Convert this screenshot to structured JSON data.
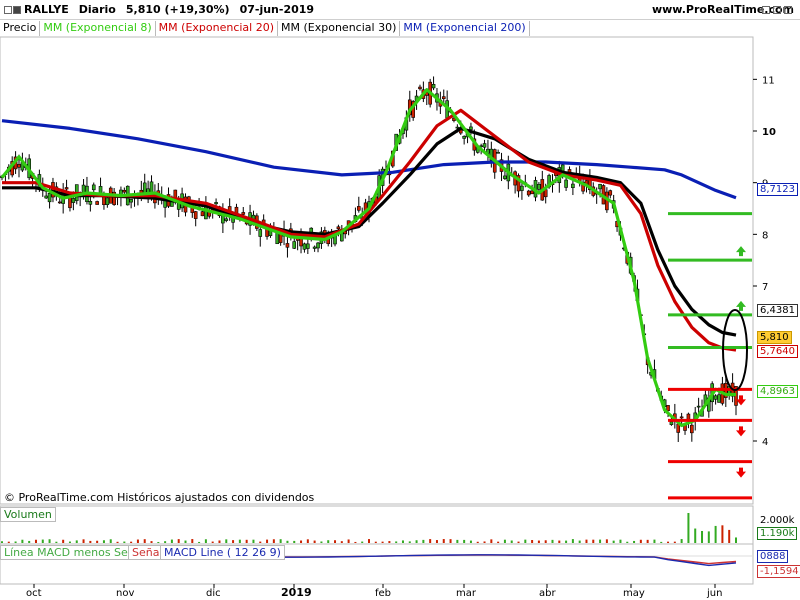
{
  "header": {
    "symbol": "RALLYE",
    "period": "Diario",
    "price_change": "5,810 (+19,30%)",
    "date": "07-jun-2019",
    "site": "www.ProRealTime.com"
  },
  "legend": {
    "price": "Precio",
    "ema8": "MM (Exponencial 8)",
    "ema20": "MM (Exponencial 20)",
    "ema30": "MM (Exponencial 30)",
    "ema200": "MM (Exponencial 200)"
  },
  "colors": {
    "ema8": "#33cc11",
    "ema20": "#cc0000",
    "ema30": "#000000",
    "ema200": "#0a1fb4",
    "support_line": "#33bb22",
    "resistance_line": "#ee0000",
    "candle_up": "#33aa22",
    "candle_down": "#cc2200"
  },
  "copyright": "© ProRealTime.com Históricos ajustados con dividendos",
  "volume_panel": {
    "label": "Volumen",
    "ticks": [
      "2.000k",
      "1.190k"
    ]
  },
  "macd_panel": {
    "label_histogram": "Línea MACD menos Señal",
    "label_signal": "Señal",
    "label_macd": "MACD Line ( 12 26 9)",
    "ticks": [
      "0888",
      "-1,1594"
    ]
  },
  "value_tags": {
    "ema200": "8,7123",
    "level": "6,4381",
    "price": "5,810",
    "ema20": "5,7640",
    "ema8": "4,8963"
  },
  "chart_data": {
    "type": "line",
    "y_axis_ticks": [
      "11",
      "10",
      "9",
      "8",
      "7",
      "4"
    ],
    "ylim": [
      2.8,
      11.8
    ],
    "x_axis_ticks": [
      "oct",
      "nov",
      "dic",
      "2019",
      "feb",
      "mar",
      "abr",
      "may",
      "jun"
    ],
    "series": [
      {
        "name": "MM (Exponencial 8)",
        "x": [
          0,
          5,
          12,
          18,
          25,
          35,
          45,
          55,
          70,
          85,
          95,
          100,
          108,
          113,
          120,
          125,
          132,
          140,
          150,
          158,
          165,
          172,
          180,
          186,
          190,
          195,
          200,
          204,
          207,
          210,
          213,
          216
        ],
        "values": [
          9.1,
          9.5,
          8.9,
          8.7,
          8.8,
          8.75,
          8.8,
          8.55,
          8.3,
          7.95,
          7.9,
          8.05,
          8.5,
          9.2,
          10.4,
          10.8,
          10.4,
          9.7,
          9.15,
          8.8,
          9.15,
          8.95,
          8.6,
          7.1,
          5.6,
          4.6,
          4.3,
          4.4,
          4.7,
          5.0,
          4.9,
          4.9
        ]
      },
      {
        "name": "MM (Exponencial 20)",
        "x": [
          0,
          10,
          20,
          30,
          45,
          60,
          75,
          85,
          95,
          105,
          112,
          120,
          128,
          135,
          145,
          155,
          165,
          175,
          182,
          188,
          193,
          198,
          203,
          208,
          212,
          216
        ],
        "values": [
          9.0,
          9.0,
          8.8,
          8.75,
          8.75,
          8.6,
          8.25,
          8.0,
          7.95,
          8.2,
          8.75,
          9.4,
          10.1,
          10.4,
          9.9,
          9.4,
          9.15,
          9.05,
          8.95,
          8.4,
          7.4,
          6.7,
          6.2,
          5.9,
          5.8,
          5.76
        ]
      },
      {
        "name": "MM (Exponencial 30)",
        "x": [
          0,
          10,
          20,
          30,
          45,
          60,
          75,
          85,
          95,
          105,
          112,
          120,
          128,
          135,
          145,
          155,
          165,
          175,
          182,
          188,
          193,
          198,
          203,
          208,
          212,
          216
        ],
        "values": [
          8.9,
          8.9,
          8.75,
          8.75,
          8.7,
          8.55,
          8.2,
          8.05,
          8.0,
          8.15,
          8.6,
          9.15,
          9.75,
          10.05,
          9.85,
          9.45,
          9.2,
          9.1,
          9.0,
          8.6,
          7.7,
          7.0,
          6.55,
          6.25,
          6.1,
          6.05
        ]
      },
      {
        "name": "MM (Exponencial 200)",
        "x": [
          0,
          20,
          40,
          60,
          80,
          100,
          115,
          130,
          145,
          160,
          175,
          185,
          195,
          200,
          205,
          210,
          216
        ],
        "values": [
          10.2,
          10.05,
          9.85,
          9.6,
          9.3,
          9.15,
          9.2,
          9.35,
          9.4,
          9.4,
          9.35,
          9.3,
          9.25,
          9.15,
          9.0,
          8.85,
          8.71
        ]
      }
    ],
    "horizontal_levels": [
      {
        "value": 8.4,
        "color": "green",
        "arrow": "none"
      },
      {
        "value": 7.5,
        "color": "green",
        "arrow": "up"
      },
      {
        "value": 6.44,
        "color": "green",
        "arrow": "up"
      },
      {
        "value": 5.81,
        "color": "green",
        "arrow": "none"
      },
      {
        "value": 5.0,
        "color": "red",
        "arrow": "down"
      },
      {
        "value": 4.4,
        "color": "red",
        "arrow": "down"
      },
      {
        "value": 3.6,
        "color": "red",
        "arrow": "down"
      },
      {
        "value": 2.9,
        "color": "red",
        "arrow": "none"
      }
    ],
    "grid": false
  }
}
